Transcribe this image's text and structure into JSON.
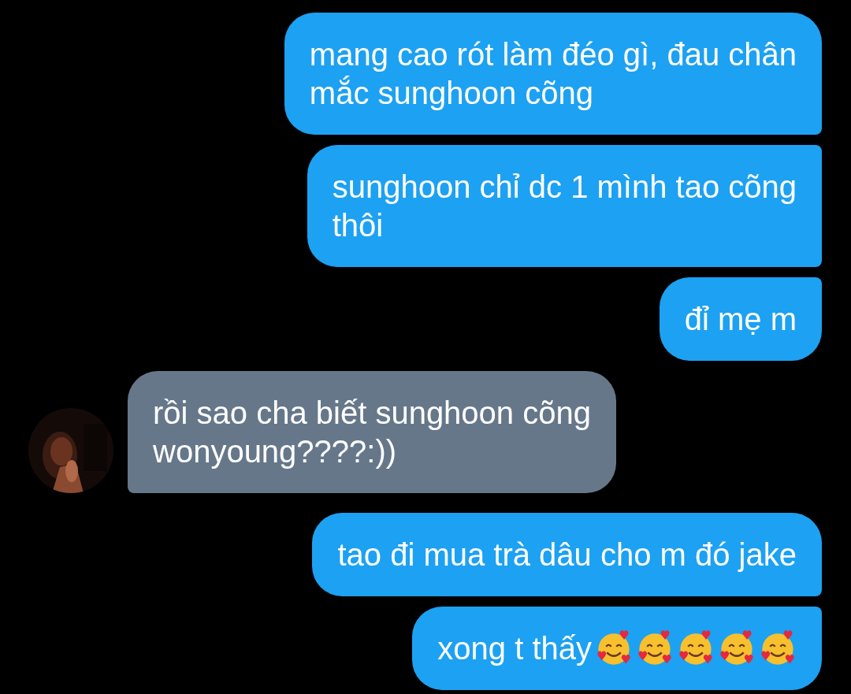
{
  "messages": [
    {
      "kind": "sent",
      "lines": [
        "mang cao rót làm đéo gì, đau chân",
        "mắc sunghoon cõng"
      ]
    },
    {
      "kind": "sent",
      "lines": [
        "sunghoon chỉ dc 1 mình tao cõng",
        "thôi"
      ]
    },
    {
      "kind": "sent",
      "lines": [
        "đỉ mẹ m"
      ]
    },
    {
      "kind": "received",
      "lines": [
        "rồi sao cha biết sunghoon cõng",
        "wonyoung????:))"
      ]
    },
    {
      "kind": "sent",
      "lines": [
        "tao đi mua trà dâu cho m đó jake"
      ]
    },
    {
      "kind": "sent",
      "lines": [
        "xong t thấy"
      ],
      "emojis": [
        {
          "kind": "smiling-face-with-hearts"
        },
        {
          "kind": "smiling-face-with-hearts"
        },
        {
          "kind": "smiling-face-with-hearts"
        },
        {
          "kind": "smiling-face-with-hearts"
        },
        {
          "kind": "smiling-face-with-hearts"
        }
      ]
    }
  ]
}
